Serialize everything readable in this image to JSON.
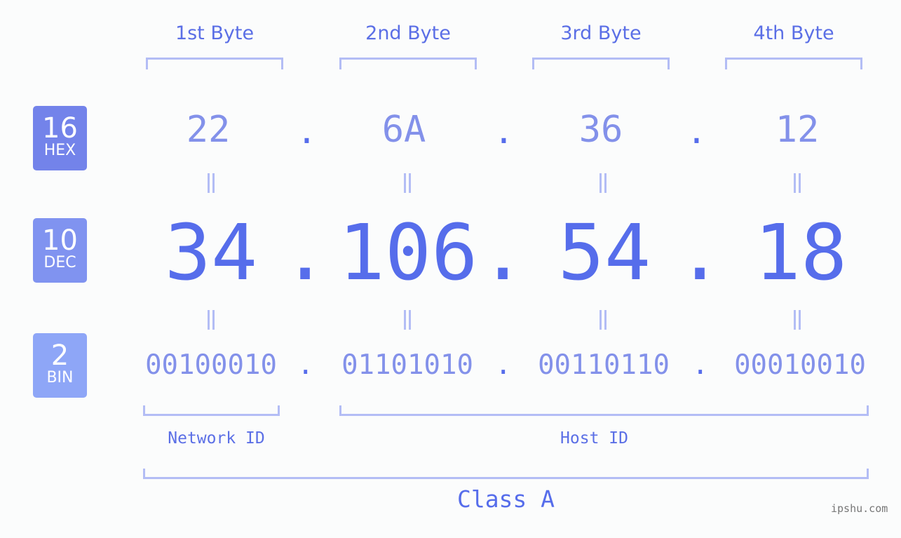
{
  "bases": [
    {
      "num": "16",
      "label": "HEX",
      "color": "#7383ea"
    },
    {
      "num": "10",
      "label": "DEC",
      "color": "#8093f0"
    },
    {
      "num": "2",
      "label": "BIN",
      "color": "#8ea6f7"
    }
  ],
  "bytes": [
    {
      "header": "1st Byte",
      "hex": "22",
      "dec": "34",
      "bin": "00100010"
    },
    {
      "header": "2nd Byte",
      "hex": "6A",
      "dec": "106",
      "bin": "01101010"
    },
    {
      "header": "3rd Byte",
      "hex": "36",
      "dec": "54",
      "bin": "00110110"
    },
    {
      "header": "4th Byte",
      "hex": "12",
      "dec": "18",
      "bin": "00010010"
    }
  ],
  "separator": ".",
  "equals": "=",
  "network_id_label": "Network ID",
  "host_id_label": "Host ID",
  "class_label": "Class A",
  "watermark": "ipshu.com"
}
